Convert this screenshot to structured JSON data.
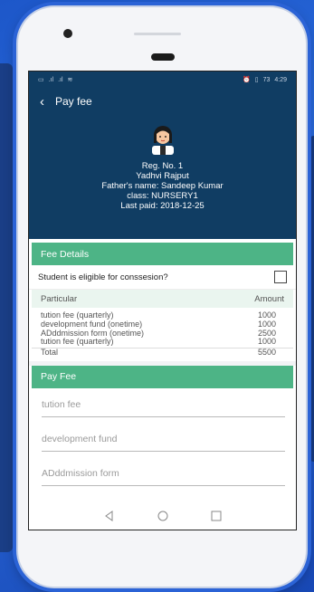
{
  "status_bar": {
    "left_icons": [
      "image-icon",
      "signal-icon",
      "signal-icon",
      "wifi-icon"
    ],
    "right_icons": [
      "alarm-icon",
      "vibrate-icon"
    ],
    "battery": "73",
    "time": "4:29"
  },
  "appbar": {
    "title": "Pay fee"
  },
  "student": {
    "reg_no": "Reg. No. 1",
    "name": "Yadhvi Rajput",
    "father": "Father's name: Sandeep Kumar",
    "class": "class: NURSERY1",
    "last_paid": "Last paid: 2018-12-25"
  },
  "fee_details": {
    "header": "Fee Details",
    "eligible_label": "Student is eligible for conssesion?",
    "col_particular": "Particular",
    "col_amount": "Amount",
    "rows": [
      {
        "particular": "tution fee (quarterly)",
        "amount": "1000"
      },
      {
        "particular": "development fund (onetime)",
        "amount": "1000"
      },
      {
        "particular": "ADddmission form (onetime)",
        "amount": "2500"
      },
      {
        "particular": "tution fee (quarterly)",
        "amount": "1000"
      }
    ],
    "total_label": "Total",
    "total_value": "5500"
  },
  "pay_fee": {
    "header": "Pay Fee",
    "fields": [
      {
        "placeholder": "tution fee"
      },
      {
        "placeholder": "development fund"
      },
      {
        "placeholder": "ADddmission form"
      }
    ]
  },
  "colors": {
    "primary": "#103d63",
    "accent": "#4db486"
  }
}
